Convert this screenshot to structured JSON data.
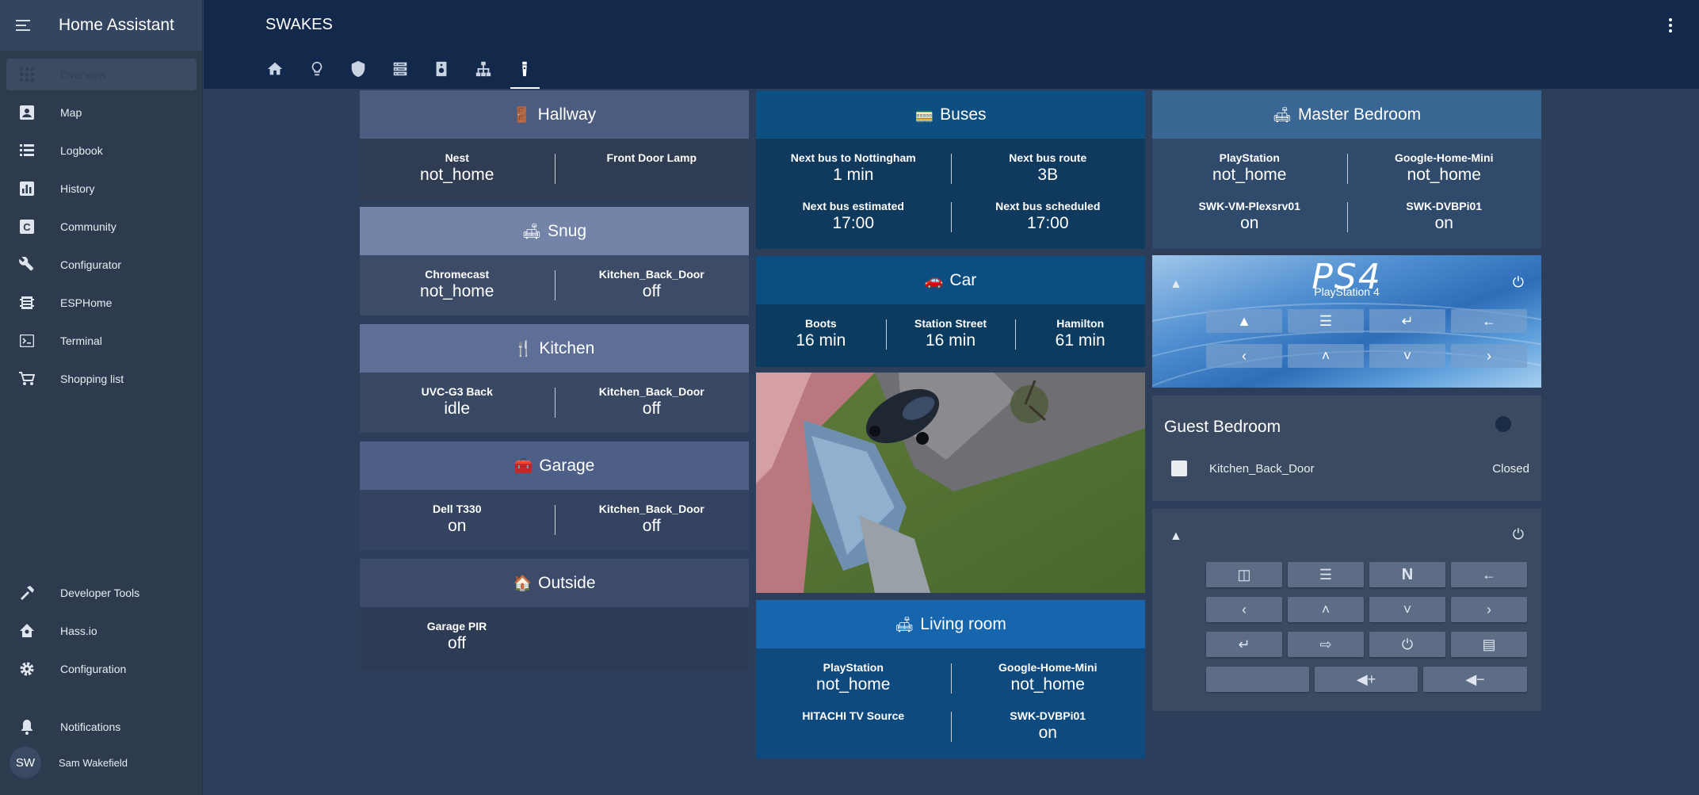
{
  "app": {
    "title": "Home Assistant"
  },
  "sidebar": {
    "items": [
      {
        "label": "Overview",
        "icon": "apps-icon"
      },
      {
        "label": "Map",
        "icon": "account-box-icon"
      },
      {
        "label": "Logbook",
        "icon": "format-list-icon"
      },
      {
        "label": "History",
        "icon": "chart-box-icon"
      },
      {
        "label": "Community",
        "icon": "community-icon"
      },
      {
        "label": "Configurator",
        "icon": "wrench-icon"
      },
      {
        "label": "ESPHome",
        "icon": "chip-icon"
      },
      {
        "label": "Terminal",
        "icon": "console-icon"
      },
      {
        "label": "Shopping list",
        "icon": "cart-icon"
      }
    ],
    "bottom": [
      {
        "label": "Developer Tools",
        "icon": "hammer-icon"
      },
      {
        "label": "Hass.io",
        "icon": "home-assistant-icon"
      },
      {
        "label": "Configuration",
        "icon": "cog-icon"
      }
    ],
    "notifications": "Notifications",
    "user": {
      "initials": "SW",
      "name": "Sam Wakefield"
    }
  },
  "header": {
    "title": "SWAKES",
    "tabs": [
      "home-icon",
      "lightbulb-icon",
      "shield-icon",
      "server-icon",
      "speaker-icon",
      "network-icon",
      "remote-icon"
    ]
  },
  "cards": {
    "hallway": {
      "title": "Hallway",
      "emoji": "🚪",
      "items": [
        {
          "name": "Nest",
          "state": "not_home"
        },
        {
          "name": "Front Door Lamp",
          "state": ""
        }
      ]
    },
    "snug": {
      "title": "Snug",
      "emoji": "🛋",
      "items": [
        {
          "name": "Chromecast",
          "state": "not_home"
        },
        {
          "name": "Kitchen_Back_Door",
          "state": "off"
        }
      ]
    },
    "kitchen": {
      "title": "Kitchen",
      "emoji": "🍴",
      "items": [
        {
          "name": "UVC-G3 Back",
          "state": "idle"
        },
        {
          "name": "Kitchen_Back_Door",
          "state": "off"
        }
      ]
    },
    "garage": {
      "title": "Garage",
      "emoji": "🧰",
      "items": [
        {
          "name": "Dell T330",
          "state": "on"
        },
        {
          "name": "Kitchen_Back_Door",
          "state": "off"
        }
      ]
    },
    "outside": {
      "title": "Outside",
      "emoji": "🏠",
      "items": [
        {
          "name": "Garage PIR",
          "state": "off"
        }
      ]
    },
    "buses": {
      "title": "Buses",
      "emoji": "🚃",
      "items": [
        {
          "name": "Next bus to Nottingham",
          "state": "1 min"
        },
        {
          "name": "Next bus route",
          "state": "3B"
        },
        {
          "name": "Next bus estimated",
          "state": "17:00"
        },
        {
          "name": "Next bus scheduled",
          "state": "17:00"
        }
      ]
    },
    "car": {
      "title": "Car",
      "emoji": "🚗",
      "items": [
        {
          "name": "Boots",
          "state": "16 min"
        },
        {
          "name": "Station Street",
          "state": "16 min"
        },
        {
          "name": "Hamilton",
          "state": "61 min"
        }
      ]
    },
    "living": {
      "title": "Living room",
      "emoji": "🛋",
      "items": [
        {
          "name": "PlayStation",
          "state": "not_home"
        },
        {
          "name": "Google-Home-Mini",
          "state": "not_home"
        },
        {
          "name": "HITACHI TV Source",
          "state": ""
        },
        {
          "name": "SWK-DVBPi01",
          "state": "on"
        }
      ]
    },
    "master": {
      "title": "Master Bedroom",
      "emoji": "🛋",
      "items": [
        {
          "name": "PlayStation",
          "state": "not_home"
        },
        {
          "name": "Google-Home-Mini",
          "state": "not_home"
        },
        {
          "name": "SWK-VM-Plexsrv01",
          "state": "on"
        },
        {
          "name": "SWK-DVBPi01",
          "state": "on"
        }
      ]
    },
    "ps4": {
      "logo": "PS4",
      "name": "PlayStation 4"
    },
    "guest": {
      "title": "Guest Bedroom",
      "entity": "Kitchen_Back_Door",
      "state": "Closed"
    }
  }
}
